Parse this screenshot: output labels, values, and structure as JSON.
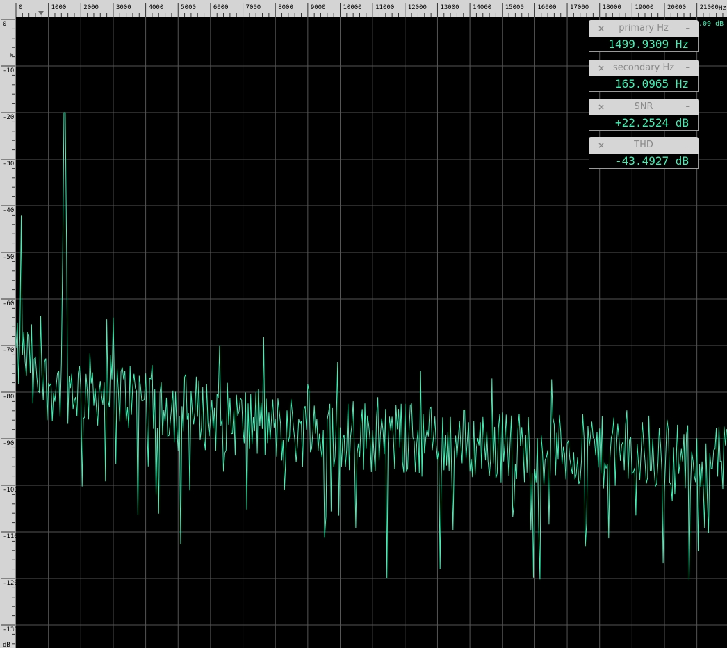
{
  "x_axis": {
    "unit_label": "Hz",
    "ticks": [
      "0",
      "1000",
      "2000",
      "3000",
      "4000",
      "5000",
      "6000",
      "7000",
      "8000",
      "9000",
      "10000",
      "11000",
      "12000",
      "13000",
      "14000",
      "15000",
      "16000",
      "17000",
      "18000",
      "19000",
      "20000",
      "21000"
    ]
  },
  "y_axis": {
    "unit_label": "dB",
    "ticks": [
      "0",
      "-10",
      "-20",
      "-30",
      "-40",
      "-50",
      "-60",
      "-70",
      "-80",
      "-90",
      "-100",
      "-110",
      "-120",
      "-130"
    ]
  },
  "corner_readout": ".09 dB",
  "meters": [
    {
      "label": "primary Hz",
      "value": "1499.9309 Hz"
    },
    {
      "label": "secondary Hz",
      "value": "165.0965 Hz"
    },
    {
      "label": "SNR",
      "value": "+22.2524 dB"
    },
    {
      "label": "THD",
      "value": "-43.4927 dB"
    }
  ],
  "controls": {
    "close_glyph": "×",
    "minimize_glyph": "–"
  },
  "colors": {
    "trace": "#3df2b5",
    "grid": "#555555",
    "background": "#000000",
    "ruler": "#d4d4d4"
  },
  "spectrum": {
    "x_range_hz": [
      0,
      22000
    ],
    "y_range_db": [
      -130,
      0
    ],
    "peaks": [
      {
        "hz": 165,
        "db": -42
      },
      {
        "hz": 1500,
        "db": -20
      },
      {
        "hz": 3000,
        "db": -64
      },
      {
        "hz": 4000,
        "db": -76
      },
      {
        "hz": 20600,
        "db": -89
      }
    ]
  }
}
